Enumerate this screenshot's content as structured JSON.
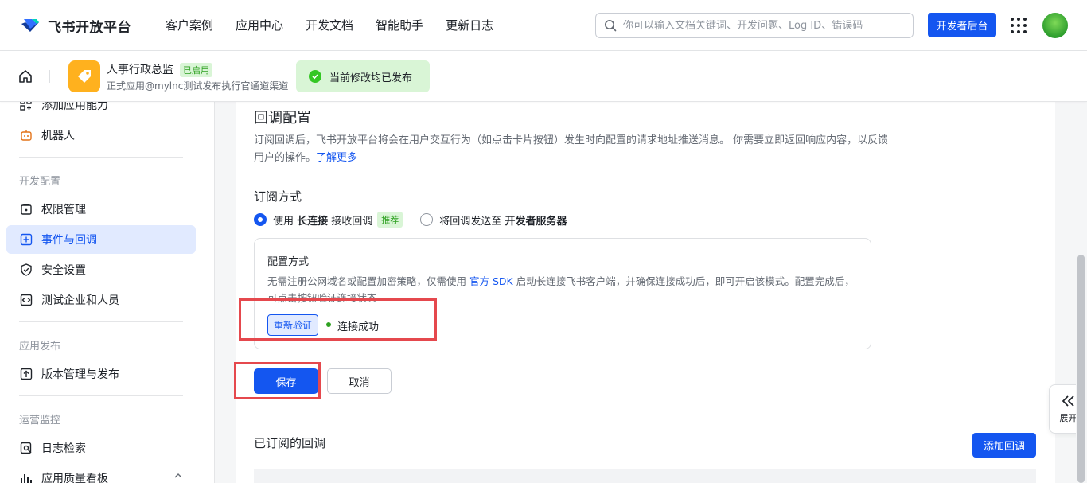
{
  "brand": {
    "name": "飞书开放平台"
  },
  "nav": {
    "items": [
      "客户案例",
      "应用中心",
      "开发文档",
      "智能助手",
      "更新日志"
    ]
  },
  "search": {
    "placeholder": "你可以输入文档关键词、开发问题、Log ID、错误码"
  },
  "header": {
    "dev_console": "开发者后台"
  },
  "app": {
    "name": "人事行政总监",
    "status": "已启用",
    "subtitle": "正式应用@mylnc测试发布执行官通道渠道",
    "publish_notice": "当前修改均已发布"
  },
  "sidebar": {
    "items_top": [
      {
        "label": "添加应用能力",
        "icon": "grid-add-icon"
      },
      {
        "label": "机器人",
        "icon": "robot-icon"
      }
    ],
    "groups": [
      {
        "title": "开发配置",
        "items": [
          {
            "label": "权限管理",
            "icon": "lock-icon"
          },
          {
            "label": "事件与回调",
            "icon": "event-icon"
          },
          {
            "label": "安全设置",
            "icon": "shield-icon"
          },
          {
            "label": "测试企业和人员",
            "icon": "code-icon"
          }
        ]
      },
      {
        "title": "应用发布",
        "items": [
          {
            "label": "版本管理与发布",
            "icon": "upload-icon"
          }
        ]
      },
      {
        "title": "运营监控",
        "items": [
          {
            "label": "日志检索",
            "icon": "log-search-icon"
          },
          {
            "label": "应用质量看板",
            "icon": "bar-chart-icon"
          }
        ]
      }
    ],
    "active": "事件与回调"
  },
  "callback": {
    "title": "回调配置",
    "desc": "订阅回调后，飞书开放平台将会在用户交互行为（如点击卡片按钮）发生时向配置的请求地址推送消息。 你需要立即返回响应内容，以反馈用户的操作。",
    "learn_more": "了解更多",
    "subscribe_title": "订阅方式",
    "option1": {
      "pre": "使用 ",
      "bold": "长连接",
      "post": " 接收回调",
      "tag": "推荐",
      "selected": true
    },
    "option2": {
      "pre": "将回调发送至 ",
      "bold": "开发者服务器",
      "selected": false
    },
    "config_title": "配置方式",
    "config_desc_a": "无需注册公网域名或配置加密策略，仅需使用 ",
    "config_desc_sdk": "官方 SDK",
    "config_desc_b": " 启动长连接飞书客户端，并确保连接成功后，即可开启该模式。配置完成后，可点击按钮验证连接状态",
    "reverify": "重新验证",
    "conn_status": "连接成功",
    "save": "保存",
    "cancel": "取消",
    "subscribed_title": "已订阅的回调",
    "add_callback": "添加回调"
  },
  "expand_panel": {
    "label": "展开"
  },
  "colors": {
    "accent": "#1456f0",
    "success": "#34c724",
    "annotation": "#e5484d",
    "app_icon": "#ffb11e"
  }
}
